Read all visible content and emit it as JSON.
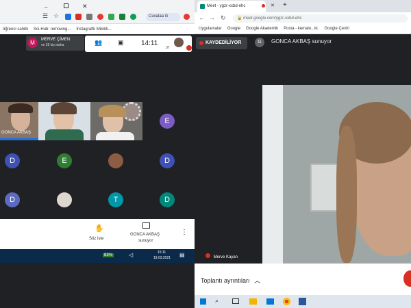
{
  "left": {
    "tabs": {
      "profile_label": "Cuvalaa G"
    },
    "bookmarks": [
      "öğrenci sahibi",
      "Sci-Hub: removing...",
      "İnstagrafik Mikibli..."
    ],
    "meeting": {
      "host_initial": "M",
      "host_name": "MERVE ÇİMEN",
      "host_sub": "ve 28 kişi daha",
      "time": "14:11",
      "participants_count": "37",
      "presenter_video_label": "GONCA AKBAŞ",
      "tiles": [
        "E",
        "D",
        "E",
        "D",
        "D",
        "T",
        "D"
      ]
    },
    "bottom": {
      "raise_hand_label": "Söz iste",
      "presenting_name": "GONCA AKBAŞ",
      "presenting_sub": "sunuyor"
    },
    "taskbar": {
      "battery": "83%",
      "time": "15:11",
      "date": "19.03.2021"
    }
  },
  "right": {
    "tab_title": "Meet - ygzr-xxbd-ehc",
    "url": "meet.google.com/ygzr-xxbd-ehc",
    "bookmarks": [
      "Uygulamalar",
      "Google",
      "Google Akademik",
      "Posta - kemalo...kt.",
      "Google Çeviri"
    ],
    "recording_label": "KAYDEDİLİYOR",
    "presenter_initial": "G",
    "presenter_text": "GONCA AKBAŞ sunuyor",
    "speaker_name": "Merve Kayan",
    "details_label": "Toplantı ayrıntıları"
  }
}
